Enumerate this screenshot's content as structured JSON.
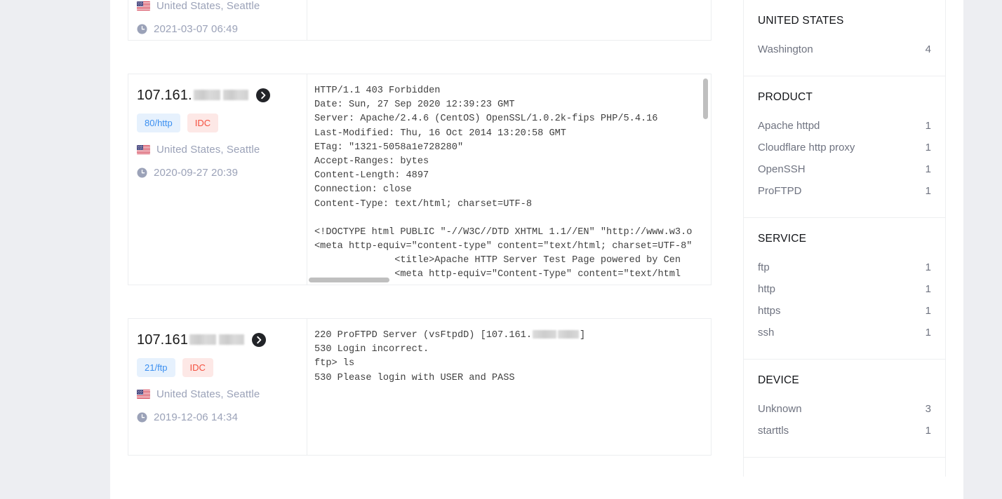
{
  "results": [
    {
      "id": "result-1",
      "ip_prefix": "",
      "redacted": false,
      "tags": [],
      "location": "United States, Seattle",
      "timestamp": "2021-03-07 06:49",
      "banner_lines": [],
      "partial_top": true
    },
    {
      "id": "result-2",
      "ip_prefix": "107.161.",
      "redacted": true,
      "tags": [
        {
          "label": "80/http",
          "kind": "port"
        },
        {
          "label": "IDC",
          "kind": "idc"
        }
      ],
      "location": "United States, Seattle",
      "timestamp": "2020-09-27 20:39",
      "banner_lines": [
        "HTTP/1.1 403 Forbidden",
        "Date: Sun, 27 Sep 2020 12:39:23 GMT",
        "Server: Apache/2.4.6 (CentOS) OpenSSL/1.0.2k-fips PHP/5.4.16",
        "Last-Modified: Thu, 16 Oct 2014 13:20:58 GMT",
        "ETag: \"1321-5058a1e728280\"",
        "Accept-Ranges: bytes",
        "Content-Length: 4897",
        "Connection: close",
        "Content-Type: text/html; charset=UTF-8",
        "",
        "<!DOCTYPE html PUBLIC \"-//W3C//DTD XHTML 1.1//EN\" \"http://www.w3.o",
        "<meta http-equiv=\"content-type\" content=\"text/html; charset=UTF-8\"",
        "              <title>Apache HTTP Server Test Page powered by Cen",
        "              <meta http-equiv=\"Content-Type\" content=\"text/html"
      ],
      "has_vertical_scrollbar": true,
      "has_horizontal_scrollbar": true
    },
    {
      "id": "result-3",
      "ip_prefix": "107.161",
      "redacted": true,
      "tags": [
        {
          "label": "21/ftp",
          "kind": "port"
        },
        {
          "label": "IDC",
          "kind": "idc"
        }
      ],
      "location": "United States, Seattle",
      "timestamp": "2019-12-06 14:34",
      "banner_ftp": {
        "line1_before": "220 ProFTPD Server (vsFtpdD) [107.161.",
        "line1_after": "]",
        "lines_rest": [
          "530 Login incorrect.",
          "ftp> ls",
          "530 Please login with USER and PASS"
        ]
      },
      "has_vertical_scrollbar": false,
      "has_horizontal_scrollbar": false
    }
  ],
  "facets": [
    {
      "title": "UNITED STATES",
      "rows": [
        {
          "label": "Washington",
          "count": "4"
        }
      ]
    },
    {
      "title": "PRODUCT",
      "rows": [
        {
          "label": "Apache httpd",
          "count": "1"
        },
        {
          "label": "Cloudflare http proxy",
          "count": "1"
        },
        {
          "label": "OpenSSH",
          "count": "1"
        },
        {
          "label": "ProFTPD",
          "count": "1"
        }
      ]
    },
    {
      "title": "SERVICE",
      "rows": [
        {
          "label": "ftp",
          "count": "1"
        },
        {
          "label": "http",
          "count": "1"
        },
        {
          "label": "https",
          "count": "1"
        },
        {
          "label": "ssh",
          "count": "1"
        }
      ]
    },
    {
      "title": "DEVICE",
      "rows": [
        {
          "label": "Unknown",
          "count": "3"
        },
        {
          "label": "starttls",
          "count": "1"
        }
      ]
    }
  ],
  "colors": {
    "tag_port_bg": "#e6f1fd",
    "tag_port_fg": "#3b8ff0",
    "tag_idc_bg": "#fde8e6",
    "tag_idc_fg": "#f4503f",
    "meta_text": "#9ba2b8",
    "page_gutter": "#edeef2",
    "card_border": "#eceef0",
    "code_text": "#3f3f3f"
  }
}
